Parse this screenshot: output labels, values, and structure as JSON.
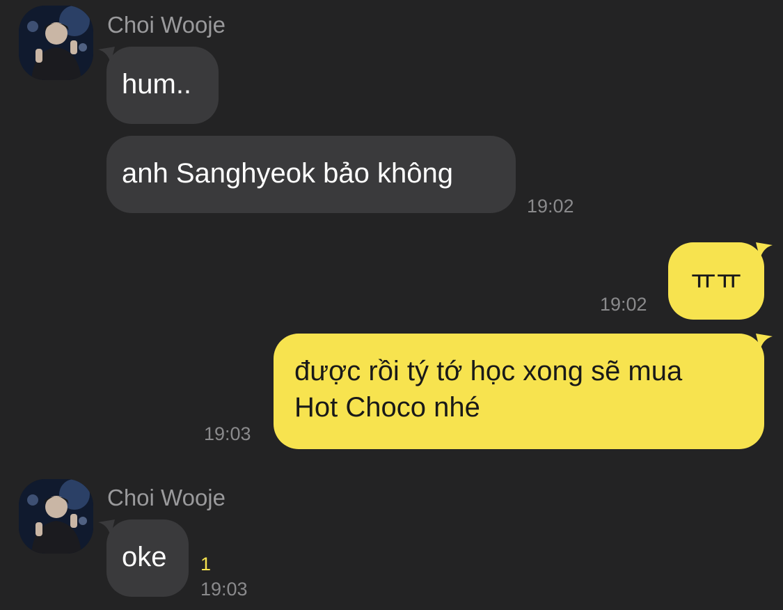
{
  "conversation": {
    "accent_color": "#f7e34f",
    "incoming_bubble_color": "#3a3a3c",
    "background_color": "#232324",
    "groups": [
      {
        "sender": "Choi Wooje",
        "avatar_icon": "profile-photo-icon",
        "messages": [
          {
            "text": "hum.."
          },
          {
            "text": "anh Sanghyeok bảo không",
            "time": "19:02"
          }
        ]
      },
      {
        "outgoing": true,
        "messages": [
          {
            "text": "ㅠㅠ",
            "time": "19:02"
          },
          {
            "line1": "được rồi tý tớ học xong sẽ mua",
            "line2": "Hot Choco nhé",
            "time": "19:03"
          }
        ]
      },
      {
        "sender": "Choi Wooje",
        "avatar_icon": "profile-photo-icon",
        "messages": [
          {
            "text": "oke",
            "unread": "1",
            "time": "19:03"
          }
        ]
      }
    ]
  }
}
